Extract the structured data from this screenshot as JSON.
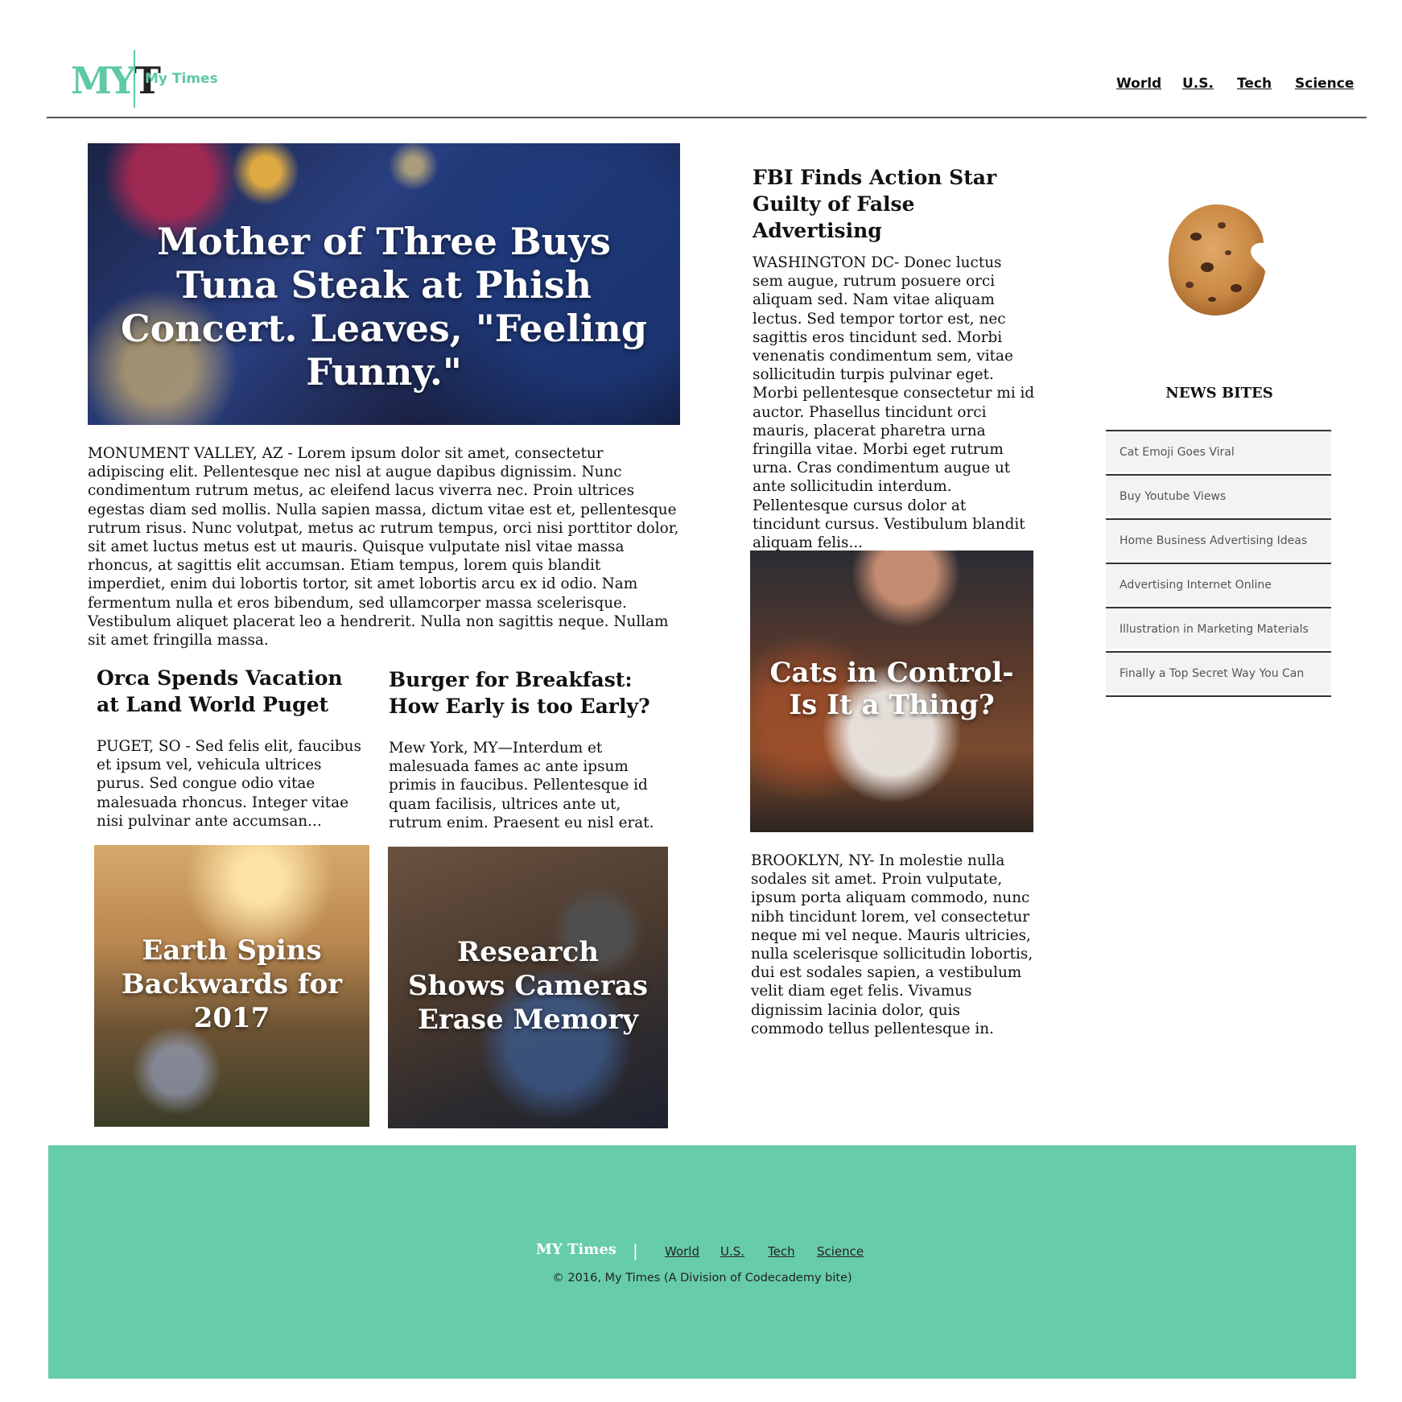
{
  "header": {
    "logo_mark_m": "MY",
    "logo_mark_t": "T",
    "brand_name": "My Times",
    "nav": [
      "World",
      "U.S.",
      "Tech",
      "Science"
    ]
  },
  "hero": {
    "title": "Mother of Three Buys Tuna Steak at Phish Concert. Leaves, \"Feeling Funny.\"",
    "body": "MONUMENT VALLEY, AZ - Lorem ipsum dolor sit amet, consectetur adipiscing elit. Pellentesque nec nisl at augue dapibus dignissim. Nunc condimentum rutrum metus, ac eleifend lacus viverra nec. Proin ultrices egestas diam sed mollis. Nulla sapien massa, dictum vitae est et, pellentesque rutrum risus. Nunc volutpat, metus ac rutrum tempus, orci nisi porttitor dolor, sit amet luctus metus est ut mauris. Quisque vulputate nisl vitae massa rhoncus, at sagittis elit accumsan. Etiam tempus, lorem quis blandit imperdiet, enim dui lobortis tortor, sit amet lobortis arcu ex id odio. Nam fermentum nulla et eros bibendum, sed ullamcorper massa scelerisque. Vestibulum aliquet placerat leo a hendrerit. Nulla non sagittis neque. Nullam sit amet fringilla massa."
  },
  "orca": {
    "title": "Orca Spends Vacation at Land World Puget",
    "body": "PUGET, SO - Sed felis elit, faucibus et ipsum vel, vehicula ultrices purus. Sed congue odio vitae malesuada rhoncus. Integer vitae nisi pulvinar ante accumsan..."
  },
  "burger": {
    "title": "Burger for Breakfast: How Early is too Early?",
    "body": "Mew York, MY—Interdum et malesuada fames ac ante ipsum primis in faucibus. Pellentesque id quam facilisis, ultrices ante ut, rutrum enim. Praesent eu nisl erat."
  },
  "earth_tile": {
    "title": "Earth Spins Backwards for 2017"
  },
  "camera_tile": {
    "title": "Research Shows Cameras Erase Memory"
  },
  "fbi": {
    "title": "FBI Finds Action Star Guilty of False Advertising",
    "body": "WASHINGTON DC- Donec luctus sem augue, rutrum posuere orci aliquam sed. Nam vitae aliquam lectus. Sed tempor tortor est, nec sagittis eros tincidunt sed. Morbi venenatis condimentum sem, vitae sollicitudin turpis pulvinar eget. Morbi pellentesque consectetur mi id auctor. Phasellus tincidunt orci mauris, placerat pharetra urna fringilla vitae. Morbi eget rutrum urna. Cras condimentum augue ut ante sollicitudin interdum. Pellentesque cursus dolor at tincidunt cursus. Vestibulum blandit aliquam felis..."
  },
  "cats": {
    "title": "Cats in Control-Is It a Thing?",
    "body": "BROOKLYN, NY- In molestie nulla sodales sit amet. Proin vulputate, ipsum porta aliquam commodo, nunc nibh tincidunt lorem, vel consectetur neque mi vel neque. Mauris ultricies, nulla scelerisque sollicitudin lobortis, dui est sodales sapien, a vestibulum velit diam eget felis. Vivamus dignissim lacinia dolor, quis commodo tellus pellentesque in."
  },
  "news_bites": {
    "title": "NEWS BITES",
    "items": [
      "Cat Emoji Goes Viral",
      "Buy Youtube Views",
      "Home Business Advertising Ideas",
      "Advertising Internet Online",
      "Illustration in Marketing Materials",
      "Finally a Top Secret Way You Can"
    ]
  },
  "footer": {
    "brand": "MY Times",
    "separator": "|",
    "links": [
      "World",
      "U.S.",
      "Tech",
      "Science"
    ],
    "copyright": "© 2016, My Times (A Division of Codecademy bite)"
  },
  "colors": {
    "accent": "#5fc9a3",
    "footer_bg": "#67cca9"
  }
}
